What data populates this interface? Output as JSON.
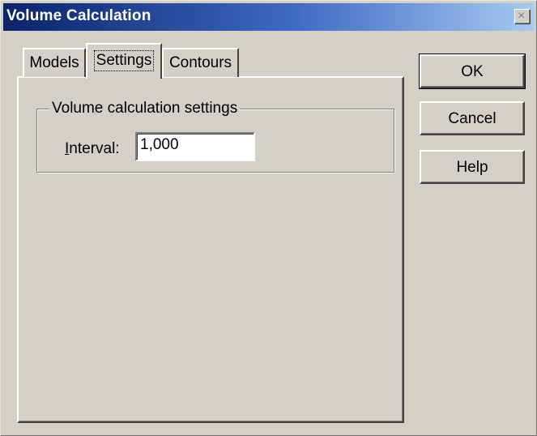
{
  "window": {
    "title": "Volume Calculation",
    "close_glyph": "×"
  },
  "tabs": [
    {
      "label": "Models",
      "selected": false
    },
    {
      "label": "Settings",
      "selected": true
    },
    {
      "label": "Contours",
      "selected": false
    }
  ],
  "settings": {
    "group_label": "Volume calculation settings",
    "interval_label_mnemonic": "I",
    "interval_label_rest": "nterval:",
    "interval_value": "1,000"
  },
  "buttons": {
    "ok": "OK",
    "cancel": "Cancel",
    "help": "Help"
  },
  "colors": {
    "titlebar_start": "#0a246a",
    "titlebar_end": "#a6caf0",
    "face": "#d4d0c8"
  }
}
